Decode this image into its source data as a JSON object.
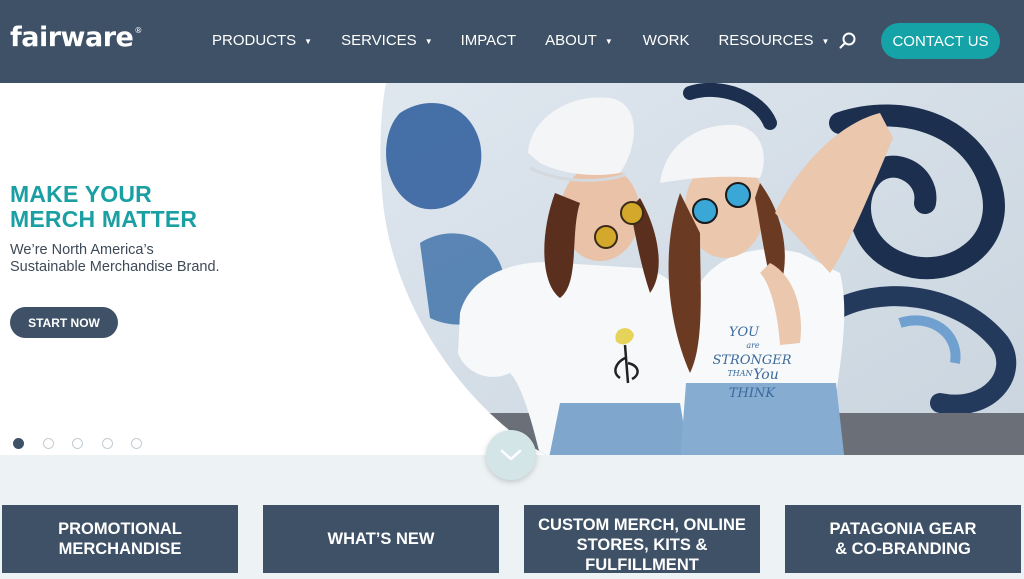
{
  "nav": {
    "logo": "fairware",
    "logo_mark": "®",
    "items": [
      {
        "label": "PRODUCTS",
        "dropdown": true
      },
      {
        "label": "SERVICES",
        "dropdown": true
      },
      {
        "label": "IMPACT",
        "dropdown": false
      },
      {
        "label": "ABOUT",
        "dropdown": true
      },
      {
        "label": "WORK",
        "dropdown": false
      },
      {
        "label": "RESOURCES",
        "dropdown": true
      }
    ],
    "caret": "▼",
    "search_icon": "search-icon",
    "contact_label": "CONTACT US"
  },
  "hero": {
    "title_line1": "MAKE YOUR",
    "title_line2": "MERCH MATTER",
    "subtitle_line1": "We’re North America’s",
    "subtitle_line2": "Sustainable Merchandise Brand.",
    "cta_label": "START NOW",
    "shirt_text": [
      "YOU",
      "are",
      "STRONGER",
      "THAN",
      "You",
      "THINK"
    ],
    "slides": 5,
    "active_slide": 1
  },
  "scroll_icon": "chevron-down-icon",
  "tiles": [
    {
      "line1": "PROMOTIONAL",
      "line2": "MERCHANDISE",
      "line3": ""
    },
    {
      "line1": "WHAT’S NEW",
      "line2": "",
      "line3": ""
    },
    {
      "line1": "CUSTOM MERCH, ONLINE",
      "line2": "STORES, KITS &",
      "line3": "FULFILLMENT"
    },
    {
      "line1": "PATAGONIA GEAR",
      "line2": "& CO-BRANDING",
      "line3": ""
    }
  ],
  "colors": {
    "nav_bg": "#3e5166",
    "accent_teal": "#16a3a7",
    "title_teal": "#1a9fa3",
    "band_bg": "#edf2f4"
  }
}
